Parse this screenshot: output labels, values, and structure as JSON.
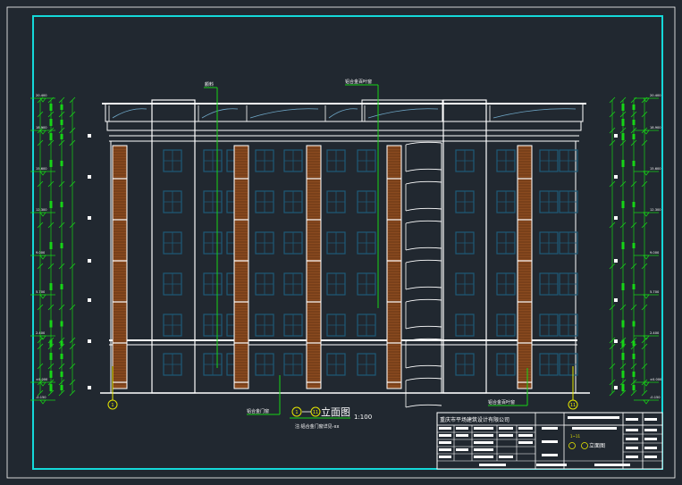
{
  "drawing": {
    "title_cn": "立面图",
    "title_scale": "1:100",
    "axis_start": "1",
    "axis_end": "11",
    "callouts": {
      "top_left": "颜料",
      "top_right": "铝合金百叶窗",
      "bottom_left": "铝合金门窗",
      "bottom_right": "铝合金百叶窗"
    },
    "sub_note": "注:铝合金门窗详见-xx",
    "elevation_marks_left": [
      "20.400",
      "18.900",
      "15.600",
      "12.300",
      "9.000",
      "5.700",
      "2.400",
      "±0.000",
      "-0.150"
    ],
    "elevation_marks_right": [
      "20.400",
      "18.900",
      "15.600",
      "12.300",
      "9.000",
      "5.700",
      "2.400",
      "±0.000",
      "-0.150"
    ]
  },
  "title_block": {
    "company": "重庆市平场建筑设计有限公司",
    "sheet_name": "立面图",
    "sheet_range": "1~11"
  },
  "colors": {
    "background": "#212830",
    "frame": "#14d9d9",
    "lines": "#ffffff",
    "dimension": "#16d416",
    "louver": "#8a4a1f",
    "window": "#1e5b78",
    "axis_bubble": "#e8e800"
  }
}
